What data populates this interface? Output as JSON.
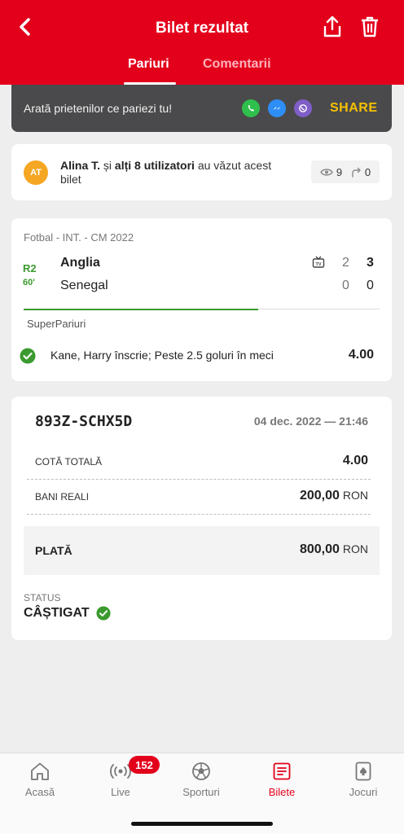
{
  "header": {
    "title": "Bilet rezultat",
    "tabs": [
      {
        "label": "Pariuri",
        "active": true
      },
      {
        "label": "Comentarii",
        "active": false
      }
    ],
    "icons": [
      "back-arrow-icon",
      "share-export-icon",
      "trash-icon"
    ],
    "color": "#e3001b"
  },
  "share": {
    "prompt": "Arată prietenilor ce pariezi tu!",
    "apps": [
      "whatsapp-icon",
      "messenger-icon",
      "viber-icon"
    ],
    "label": "SHARE",
    "label_color": "#f6c100"
  },
  "viewers": {
    "avatar_initials": "AT",
    "name": "Alina T.",
    "joiner": "și",
    "others": "alți 8 utilizatori",
    "suffix": "au văzut acest bilet",
    "views": "9",
    "shares": "0"
  },
  "event": {
    "league": "Fotbal - INT. - CM 2022",
    "period": "R2",
    "minute": "60'",
    "home": "Anglia",
    "away": "Senegal",
    "tv_icon": "tv-icon",
    "home_halftime": "2",
    "home_score": "3",
    "away_halftime": "0",
    "away_score": "0",
    "match_progress": 0.66,
    "market": "SuperPariuri",
    "selection": "Kane, Harry înscrie; Peste 2.5 goluri în meci",
    "odds": "4.00"
  },
  "ticket": {
    "id": "893Z-SCHX5D",
    "date": "04 dec. 2022 — 21:46",
    "total_odds_label": "COTĂ TOTALĂ",
    "total_odds": "4.00",
    "stake_label": "BANI REALI",
    "stake": "200,00",
    "payout_label": "PLATĂ",
    "payout": "800,00",
    "currency": "RON",
    "status_label": "STATUS",
    "status": "CÂȘTIGAT"
  },
  "nav": {
    "items": [
      {
        "label": "Acasă",
        "icon": "home-icon",
        "active": false
      },
      {
        "label": "Live",
        "icon": "live-broadcast-icon",
        "active": false
      },
      {
        "label": "Sporturi",
        "icon": "soccer-ball-icon",
        "active": false
      },
      {
        "label": "Bilete",
        "icon": "ticket-list-icon",
        "active": true
      },
      {
        "label": "Jocuri",
        "icon": "card-game-icon",
        "active": false
      }
    ],
    "live_badge": "152"
  }
}
